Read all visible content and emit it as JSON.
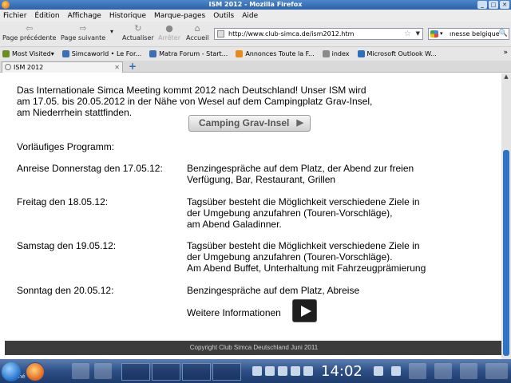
{
  "window": {
    "title": "ISM 2012 - Mozilla Firefox"
  },
  "menu": [
    "Fichier",
    "Édition",
    "Affichage",
    "Historique",
    "Marque-pages",
    "Outils",
    "Aide"
  ],
  "nav": {
    "back": "Page précédente",
    "forward": "Page suivante",
    "reload": "Actualiser",
    "stop": "Arrêter",
    "home": "Accueil",
    "url": "http://www.club-simca.de/ism2012.htm",
    "search_value": "ınesse belgique"
  },
  "bookmarks": [
    "Most Visited▾",
    "Simcaworld • Le For...",
    "Matra Forum - Start...",
    "Annonces Toute la F...",
    "index",
    "Microsoft Outlook W..."
  ],
  "bookmark_colors": [
    "#6b8e23",
    "#3c6fb4",
    "#3c6fb4",
    "#e8891a",
    "#8a8a8a",
    "#2b6fc0"
  ],
  "tabs": [
    {
      "label": "ISM 2012"
    }
  ],
  "content": {
    "intro": [
      "Das Internationale Simca Meeting kommt 2012 nach Deutschland! Unser ISM wird",
      "am 17.05. bis 20.05.2012 in der Nähe von Wesel auf dem Campingplatz Grav-Insel,",
      "am Niederrhein stattfinden."
    ],
    "camping_button": "Camping Grav-Insel",
    "program_title": "Vorläufiges Programm:",
    "program": [
      {
        "day": "Anreise Donnerstag den 17.05.12:",
        "lines": [
          "Benzingespräche auf dem Platz, der Abend zur freien",
          "Verfügung, Bar, Restaurant, Grillen"
        ]
      },
      {
        "day": "Freitag den 18.05.12:",
        "lines": [
          "Tagsüber besteht die Möglichkeit verschiedene Ziele in",
          "der Umgebung anzufahren (Touren-Vorschläge),",
          "am Abend Galadinner."
        ]
      },
      {
        "day": "Samstag den 19.05.12:",
        "lines": [
          "Tagsüber besteht die Möglichkeit verschiedene Ziele in",
          "der Umgebung anzufahren (Touren-Vorschläge).",
          "Am Abend Buffet, Unterhaltung mit Fahrzeugprämierung"
        ]
      },
      {
        "day": "Sonntag den 20.05.12:",
        "lines": [
          "Benzingespräche auf dem Platz, Abreise"
        ]
      }
    ],
    "more_info": "Weitere Informationen",
    "footer": "Copyright Club Simca Deutschland Juni 2011"
  },
  "status": "Terminé",
  "clock": "14:02"
}
